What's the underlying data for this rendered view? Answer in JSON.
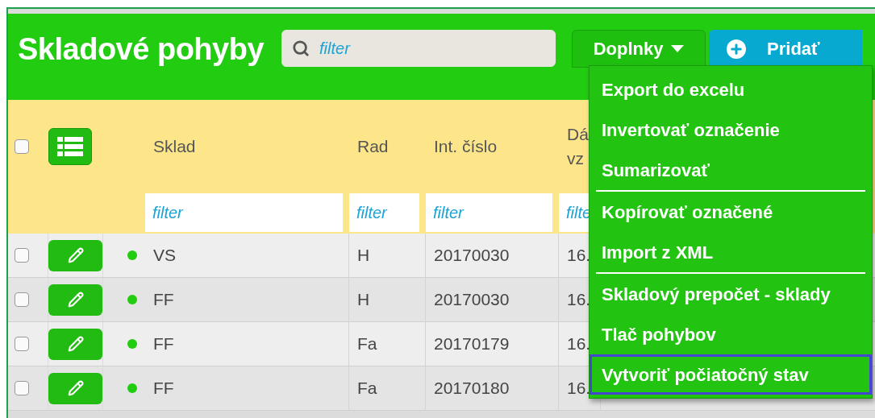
{
  "header": {
    "title": "Skladové pohyby",
    "search": {
      "placeholder": "filter"
    },
    "extras_button": {
      "label": "Doplnky",
      "expanded": true
    },
    "add_button": {
      "label": "Pridať"
    }
  },
  "menu": {
    "groups": [
      [
        {
          "label": "Export do excelu",
          "selected": false
        },
        {
          "label": "Invertovať označenie",
          "selected": false
        },
        {
          "label": "Sumarizovať",
          "selected": false
        }
      ],
      [
        {
          "label": "Kopírovať označené",
          "selected": false
        },
        {
          "label": "Import z XML",
          "selected": false
        }
      ],
      [
        {
          "label": "Skladový prepočet - sklady",
          "selected": false
        },
        {
          "label": "Tlač pohybov",
          "selected": false
        },
        {
          "label": "Vytvoriť počiatočný stav",
          "selected": true
        }
      ]
    ]
  },
  "table": {
    "select_all": {
      "checked": false
    },
    "columns": [
      {
        "label": "Sklad",
        "placeholder": "filter"
      },
      {
        "label": "Rad",
        "placeholder": "filter"
      },
      {
        "label": "Int. číslo",
        "placeholder": "filter"
      },
      {
        "label": "Dá vz",
        "placeholder": "filte"
      }
    ],
    "rows": [
      {
        "checked": false,
        "color": "#22cc11",
        "cells": [
          "VS",
          "H",
          "20170030",
          "16."
        ]
      },
      {
        "checked": false,
        "color": "#22cc11",
        "cells": [
          "FF",
          "H",
          "20170030",
          "16."
        ]
      },
      {
        "checked": false,
        "color": "#22cc11",
        "cells": [
          "FF",
          "Fa",
          "20170179",
          "16."
        ]
      },
      {
        "checked": false,
        "color": "#22cc11",
        "cells": [
          "FF",
          "Fa",
          "20170180",
          "16."
        ]
      }
    ]
  }
}
